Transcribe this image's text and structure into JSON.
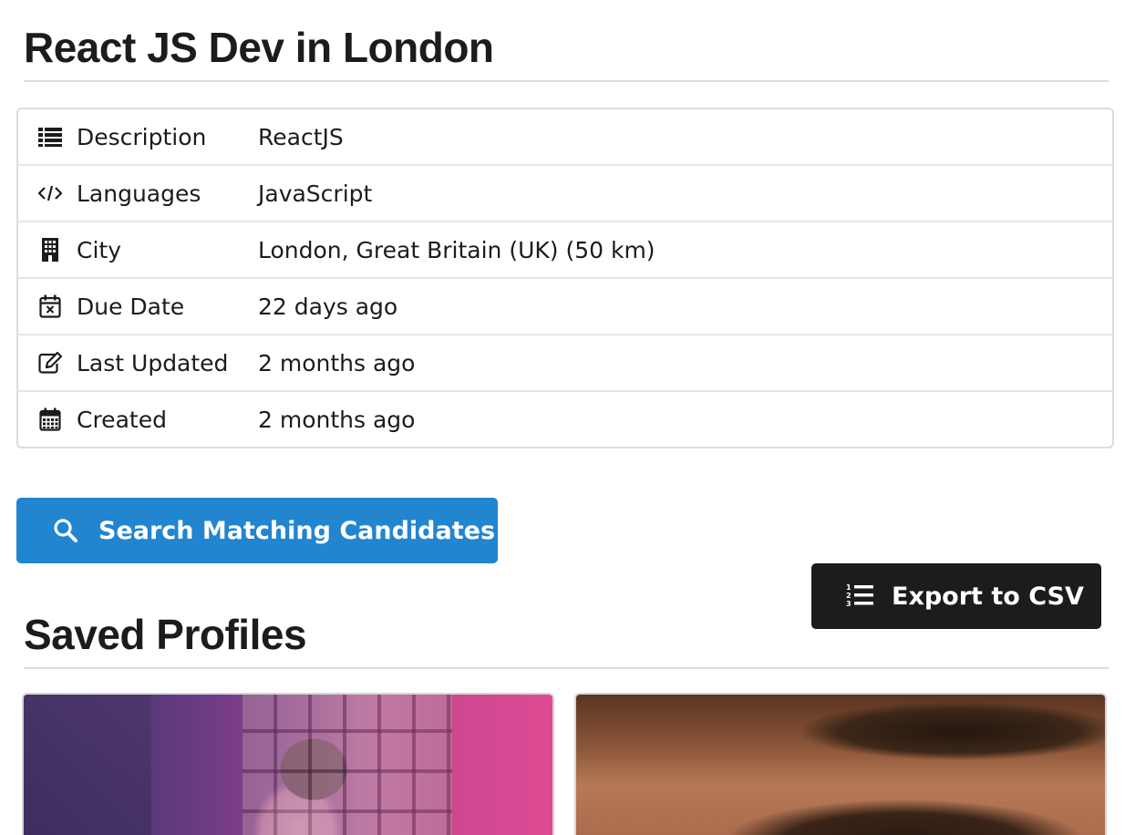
{
  "header": {
    "title": "React JS Dev in London"
  },
  "details": {
    "rows": [
      {
        "icon": "list-icon",
        "label": "Description",
        "value": "ReactJS"
      },
      {
        "icon": "code-icon",
        "label": "Languages",
        "value": "JavaScript"
      },
      {
        "icon": "building-icon",
        "label": "City",
        "value": "London, Great Britain (UK) (50 km)"
      },
      {
        "icon": "calendar-times-icon",
        "label": "Due Date",
        "value": "22 days ago"
      },
      {
        "icon": "edit-icon",
        "label": "Last Updated",
        "value": "2 months ago"
      },
      {
        "icon": "calendar-icon",
        "label": "Created",
        "value": "2 months ago"
      }
    ]
  },
  "actions": {
    "search_label": "Search Matching Candidates",
    "export_label": "Export to CSV"
  },
  "saved_profiles": {
    "title": "Saved Profiles"
  },
  "colors": {
    "primary": "#2185d0",
    "dark": "#1b1c1d",
    "border": "#dcdcdc"
  }
}
